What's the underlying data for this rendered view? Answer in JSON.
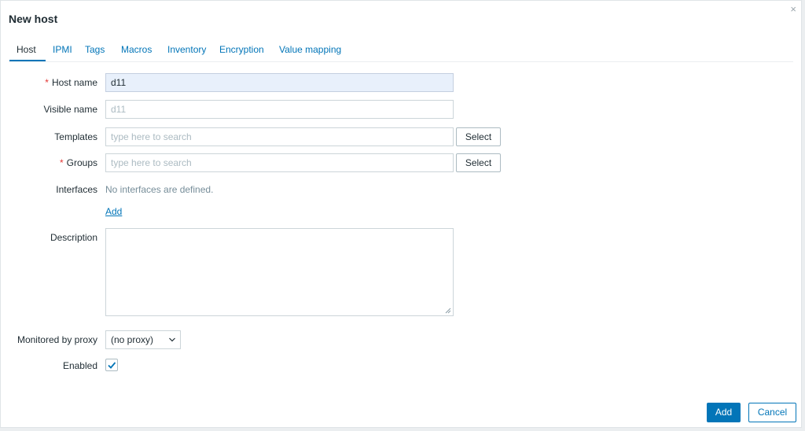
{
  "dialog": {
    "title": "New host",
    "close_glyph": "×"
  },
  "tabs": [
    {
      "label": "Host"
    },
    {
      "label": "IPMI"
    },
    {
      "label": "Tags"
    },
    {
      "label": "Macros"
    },
    {
      "label": "Inventory"
    },
    {
      "label": "Encryption"
    },
    {
      "label": "Value mapping"
    }
  ],
  "form": {
    "required_mark": "*",
    "host_name": {
      "label": "Host name",
      "value": "d11"
    },
    "visible_name": {
      "label": "Visible name",
      "placeholder": "d11"
    },
    "templates": {
      "label": "Templates",
      "placeholder": "type here to search",
      "button": "Select"
    },
    "groups": {
      "label": "Groups",
      "placeholder": "type here to search",
      "button": "Select"
    },
    "interfaces": {
      "label": "Interfaces",
      "empty_text": "No interfaces are defined.",
      "add_link": "Add"
    },
    "description": {
      "label": "Description",
      "value": ""
    },
    "proxy": {
      "label": "Monitored by proxy",
      "selected": "(no proxy)"
    },
    "enabled": {
      "label": "Enabled",
      "checked": true
    }
  },
  "footer": {
    "add_label": "Add",
    "cancel_label": "Cancel"
  },
  "colors": {
    "accent": "#0275b8",
    "required": "#e33734",
    "highlight_input": "#e8f0fb"
  },
  "icons": {
    "close": "close-icon",
    "dropdown": "chevron-down-icon",
    "check": "checkmark-icon",
    "resize": "resize-handle-icon"
  }
}
